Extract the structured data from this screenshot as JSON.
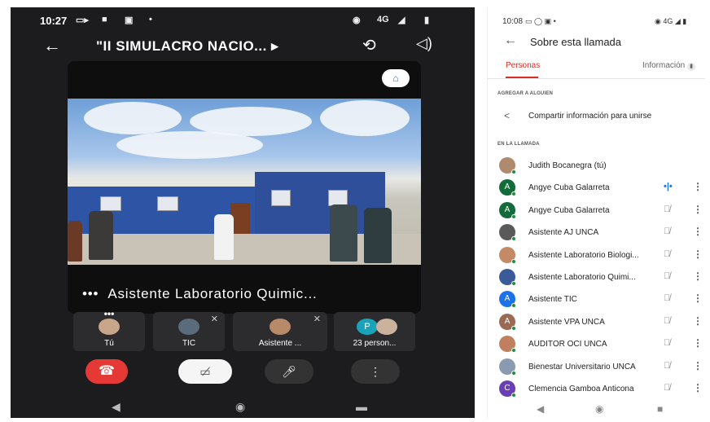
{
  "left": {
    "status": {
      "time": "10:27",
      "network": "4G"
    },
    "call_title": "\"II SIMULACRO NACIO...",
    "title_chevron": "▸",
    "speaker_label": "Asistente Laboratorio Quimic...",
    "stage_dots": "•••",
    "tiles": [
      {
        "label": "Tú",
        "dots": "•••"
      },
      {
        "label": "TIC",
        "mute": "✕"
      },
      {
        "label": "Asistente ...",
        "mute": "✕"
      },
      {
        "label": "23 person...",
        "avatar_letter": "P"
      }
    ]
  },
  "right": {
    "status": {
      "time": "10:08",
      "network": "4G"
    },
    "title": "Sobre esta llamada",
    "tabs": {
      "people": "Personas",
      "info": "Información"
    },
    "add_section": "AGREGAR A ALGUIEN",
    "share_label": "Compartir información para unirse",
    "in_call_section": "EN LA LLAMADA",
    "participants": [
      {
        "name": "Judith Bocanegra (tú)",
        "avatar": "",
        "color": "#b08a6e",
        "mic": "",
        "more": ""
      },
      {
        "name": "Angye Cuba Galarreta",
        "avatar": "A",
        "color": "#136b3a",
        "mic": "•|•",
        "more": "⋮"
      },
      {
        "name": "Angye Cuba Galarreta",
        "avatar": "A",
        "color": "#136b3a",
        "mic": "🎙̸",
        "more": "⋮"
      },
      {
        "name": "Asistente AJ UNCA",
        "avatar": "",
        "color": "#5a5a5a",
        "mic": "🎙̸",
        "more": "⋮"
      },
      {
        "name": "Asistente Laboratorio Biologi...",
        "avatar": "",
        "color": "#c48a66",
        "mic": "🎙̸",
        "more": "⋮"
      },
      {
        "name": "Asistente Laboratorio Quimi...",
        "avatar": "",
        "color": "#3a5a9a",
        "mic": "🎙̸",
        "more": "⋮"
      },
      {
        "name": "Asistente TIC",
        "avatar": "A",
        "color": "#1a73e8",
        "mic": "🎙̸",
        "more": "⋮"
      },
      {
        "name": "Asistente VPA UNCA",
        "avatar": "A",
        "color": "#9a6a55",
        "mic": "🎙̸",
        "more": "⋮"
      },
      {
        "name": "AUDITOR OCI UNCA",
        "avatar": "",
        "color": "#c08060",
        "mic": "🎙̸",
        "more": "⋮"
      },
      {
        "name": "Bienestar Universitario UNCA",
        "avatar": "",
        "color": "#8a9ab0",
        "mic": "🎙̸",
        "more": "⋮"
      },
      {
        "name": "Clemencia Gamboa Anticona",
        "avatar": "C",
        "color": "#6a3fb5",
        "mic": "🎙̸",
        "more": "⋮"
      }
    ]
  },
  "colors": {
    "end_call": "#e53935",
    "accent_red": "#d93025",
    "online": "#1e8e3e"
  }
}
